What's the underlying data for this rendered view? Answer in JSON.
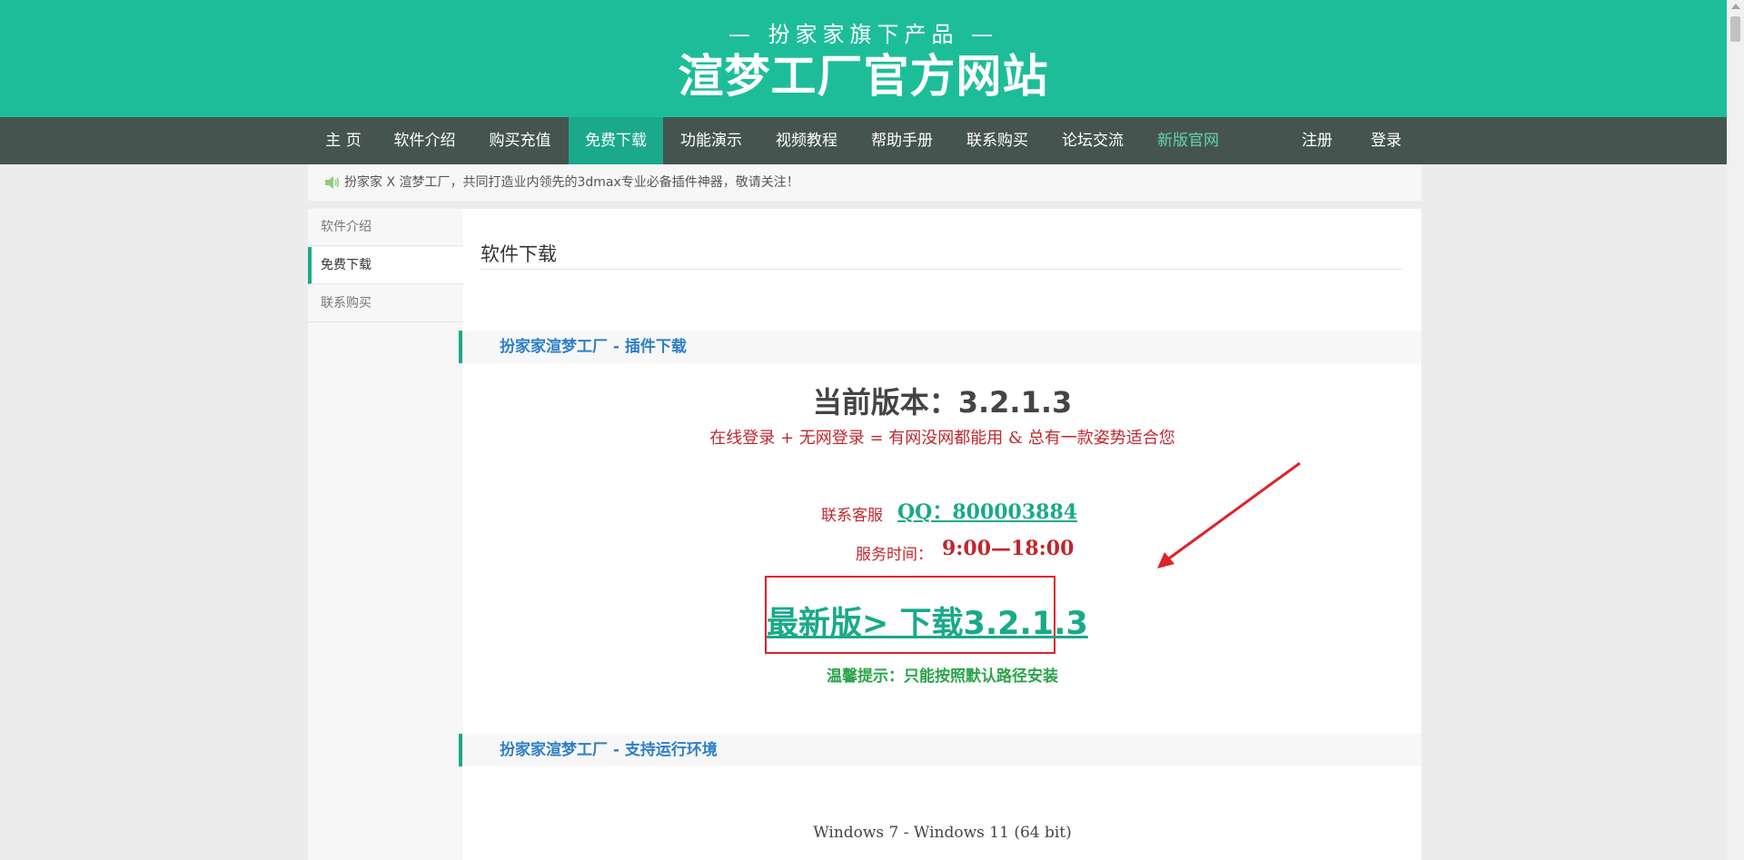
{
  "header": {
    "tagline": "— 扮家家旗下产品 —",
    "title": "渲梦工厂官方网站"
  },
  "nav": {
    "items": [
      {
        "label": "主 页"
      },
      {
        "label": "软件介绍"
      },
      {
        "label": "购买充值"
      },
      {
        "label": "免费下载",
        "active": true
      },
      {
        "label": "功能演示"
      },
      {
        "label": "视频教程"
      },
      {
        "label": "帮助手册"
      },
      {
        "label": "联系购买"
      },
      {
        "label": "论坛交流"
      },
      {
        "label": "新版官网",
        "highlight": true
      },
      {
        "label": "注册"
      },
      {
        "label": "登录"
      }
    ]
  },
  "notice": {
    "text": "扮家家 X 渲梦工厂，共同打造业内领先的3dmax专业必备插件神器，敬请关注！"
  },
  "sidebar": {
    "items": [
      {
        "label": "软件介绍"
      },
      {
        "label": "免费下载",
        "active": true
      },
      {
        "label": "联系购买"
      }
    ]
  },
  "content": {
    "page_title": "软件下载",
    "section1": "扮家家渲梦工厂 - 插件下载",
    "version_text": "当前版本：3.2.1.3",
    "slogan": "在线登录 + 无网登录 = 有网没网都能用 & 总有一款姿势适合您",
    "contact_label": "联系客服",
    "qq_text": "QQ：800003884",
    "hours_label": "服务时间：",
    "hours_value": "9:00—18:00",
    "download_text": "最新版> 下载3.2.1.3",
    "tip": "温馨提示：只能按照默认路径安装",
    "section2": "扮家家渲梦工厂 - 支持运行环境",
    "os_requirement": "Windows 7 - Windows 11 (64 bit)"
  },
  "colors": {
    "brand_green": "#1dbd9a",
    "nav_bg": "#45544f",
    "accent_red": "#c0272d",
    "link_blue": "#2d7fc7"
  }
}
